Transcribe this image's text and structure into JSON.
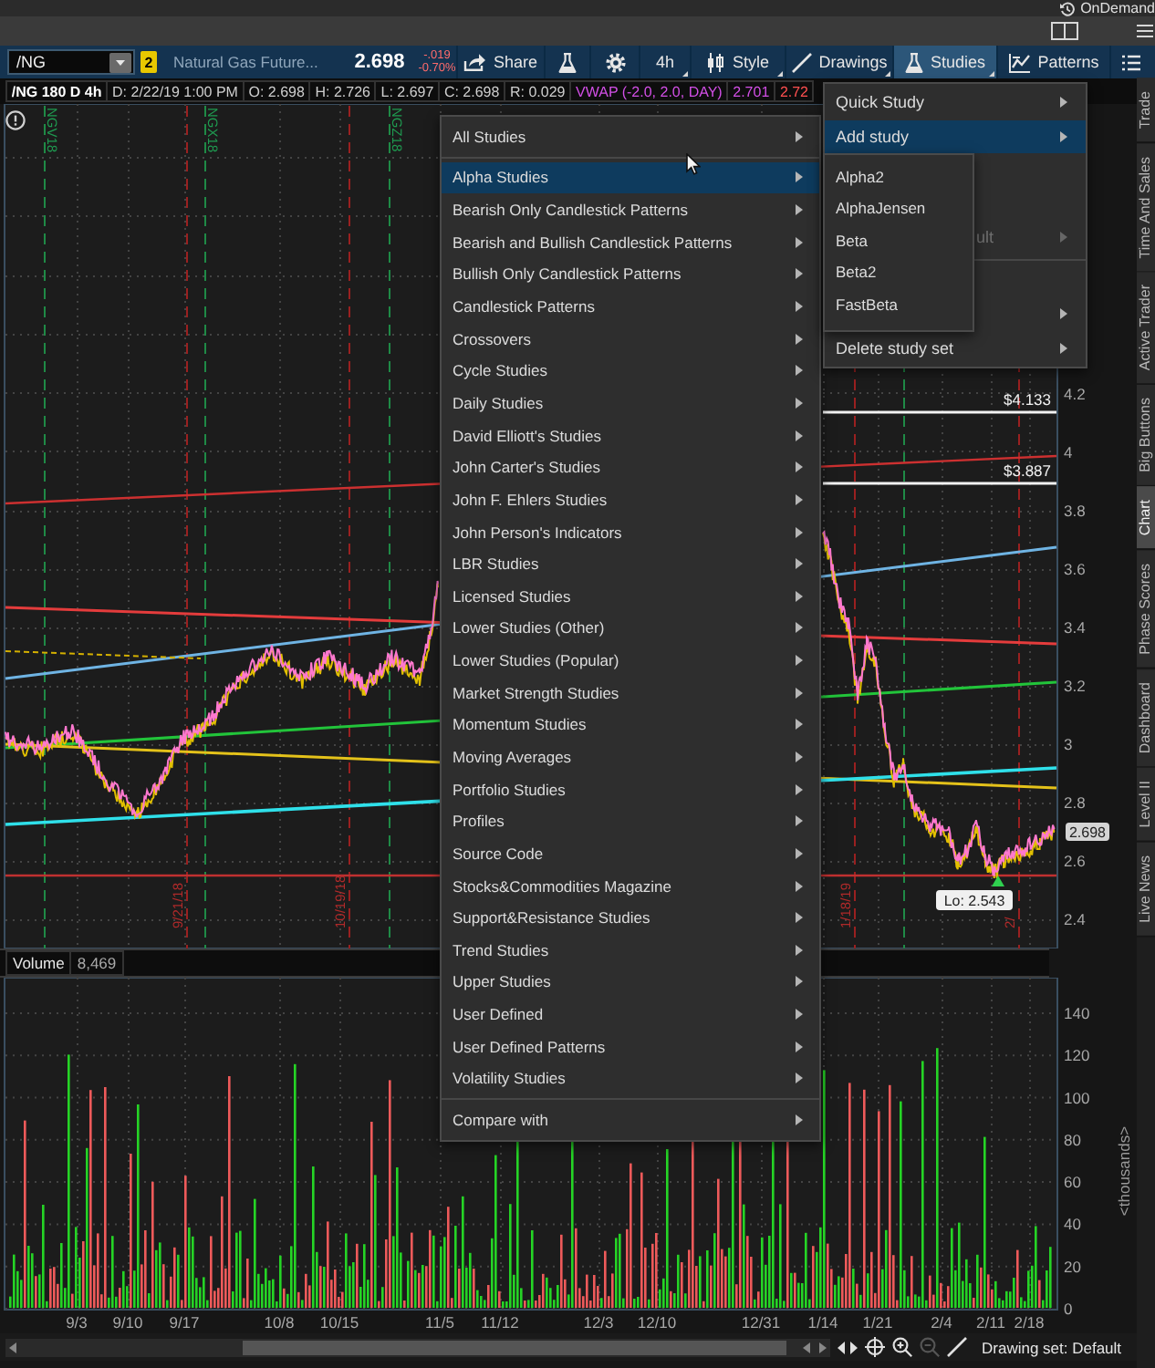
{
  "top_bar": {
    "ondemand_label": "OnDemand"
  },
  "toolbar": {
    "symbol": "/NG",
    "link_badge": "2",
    "description": "Natural Gas Future...",
    "last_price": "2.698",
    "change": "-.019",
    "change_percent": "-0.70%",
    "buttons": [
      {
        "kind": "share",
        "label": "Share",
        "selected": false
      },
      {
        "kind": "flask",
        "selected": false
      },
      {
        "kind": "gear",
        "selected": false
      },
      {
        "kind": "timeframe",
        "label": "4h",
        "selected": false
      },
      {
        "kind": "style",
        "label": "Style",
        "selected": false
      },
      {
        "kind": "drawings",
        "label": "Drawings",
        "selected": false
      },
      {
        "kind": "studies",
        "label": "Studies",
        "selected": true
      },
      {
        "kind": "patterns",
        "label": "Patterns",
        "selected": false
      },
      {
        "kind": "menu",
        "selected": false
      }
    ]
  },
  "info_bar": [
    {
      "kind": "symbol",
      "text": "/NG 180 D 4h"
    },
    {
      "kind": "field",
      "text": "D: 2/22/19 1:00 PM"
    },
    {
      "kind": "field",
      "text": "O: 2.698"
    },
    {
      "kind": "field",
      "text": "H: 2.726"
    },
    {
      "kind": "field",
      "text": "L: 2.697"
    },
    {
      "kind": "field",
      "text": "C: 2.698"
    },
    {
      "kind": "field",
      "text": "R: 0.029"
    },
    {
      "kind": "study",
      "text": "VWAP (-2.0, 2.0, DAY)"
    },
    {
      "kind": "study",
      "text": "2.701"
    },
    {
      "kind": "down",
      "text": "2.72"
    }
  ],
  "price_chart": {
    "axis_labels": [
      "4.2",
      "4",
      "3.8",
      "3.6",
      "3.4",
      "3.2",
      "3",
      "2.8",
      "2.6",
      "2.4"
    ],
    "contract_labels": [
      "NGV18",
      "NGX18",
      "NGZ18"
    ],
    "expiry_labels": [
      "9/21/18",
      "10/19/18",
      "1/18/19",
      "2/"
    ],
    "level_labels": [
      "$4.133",
      "$3.887"
    ],
    "last_price_tag": "2.698",
    "low_label": "Lo: 2.543"
  },
  "volume": {
    "title": "Volume",
    "value": "8,469",
    "axis_labels": [
      "140",
      "120",
      "100",
      "80",
      "60",
      "40",
      "20",
      "0"
    ],
    "unit": "<thousands>"
  },
  "time_axis": [
    "9/3",
    "9/10",
    "9/17",
    "10/8",
    "10/15",
    "11/5",
    "11/12",
    "12/3",
    "12/10",
    "12/31",
    "1/14",
    "1/21",
    "2/4",
    "2/11",
    "2/18"
  ],
  "bottom_bar": {
    "drawing_set": "Drawing set: Default"
  },
  "side_tabs": [
    {
      "label": "Trade",
      "selected": false
    },
    {
      "label": "Time And Sales",
      "selected": false
    },
    {
      "label": "Active Trader",
      "selected": false
    },
    {
      "label": "Big Buttons",
      "selected": false
    },
    {
      "label": "Chart",
      "selected": true
    },
    {
      "label": "Phase Scores",
      "selected": false
    },
    {
      "label": "Dashboard",
      "selected": false
    },
    {
      "label": "Level II",
      "selected": false
    },
    {
      "label": "Live News",
      "selected": false
    }
  ],
  "all_studies_menu": [
    {
      "kind": "item",
      "label": "All Studies",
      "submenu": true,
      "selected": false
    },
    {
      "kind": "separator"
    },
    {
      "kind": "item",
      "label": "Alpha Studies",
      "submenu": true,
      "selected": true
    },
    {
      "kind": "item",
      "label": "Bearish Only Candlestick Patterns",
      "submenu": true,
      "selected": false
    },
    {
      "kind": "item",
      "label": "Bearish and Bullish Candlestick Patterns",
      "submenu": true,
      "selected": false
    },
    {
      "kind": "item",
      "label": "Bullish Only Candlestick Patterns",
      "submenu": true,
      "selected": false
    },
    {
      "kind": "item",
      "label": "Candlestick Patterns",
      "submenu": true,
      "selected": false
    },
    {
      "kind": "item",
      "label": "Crossovers",
      "submenu": true,
      "selected": false
    },
    {
      "kind": "item",
      "label": "Cycle Studies",
      "submenu": true,
      "selected": false
    },
    {
      "kind": "item",
      "label": "Daily Studies",
      "submenu": true,
      "selected": false
    },
    {
      "kind": "item",
      "label": "David Elliott's Studies",
      "submenu": true,
      "selected": false
    },
    {
      "kind": "item",
      "label": "John Carter's Studies",
      "submenu": true,
      "selected": false
    },
    {
      "kind": "item",
      "label": "John F. Ehlers Studies",
      "submenu": true,
      "selected": false
    },
    {
      "kind": "item",
      "label": "John Person's Indicators",
      "submenu": true,
      "selected": false
    },
    {
      "kind": "item",
      "label": "LBR Studies",
      "submenu": true,
      "selected": false
    },
    {
      "kind": "item",
      "label": "Licensed Studies",
      "submenu": true,
      "selected": false
    },
    {
      "kind": "item",
      "label": "Lower Studies (Other)",
      "submenu": true,
      "selected": false
    },
    {
      "kind": "item",
      "label": "Lower Studies (Popular)",
      "submenu": true,
      "selected": false
    },
    {
      "kind": "item",
      "label": "Market Strength Studies",
      "submenu": true,
      "selected": false
    },
    {
      "kind": "item",
      "label": "Momentum Studies",
      "submenu": true,
      "selected": false
    },
    {
      "kind": "item",
      "label": "Moving Averages",
      "submenu": true,
      "selected": false
    },
    {
      "kind": "item",
      "label": "Portfolio Studies",
      "submenu": true,
      "selected": false
    },
    {
      "kind": "item",
      "label": "Profiles",
      "submenu": true,
      "selected": false
    },
    {
      "kind": "item",
      "label": "Source Code",
      "submenu": true,
      "selected": false
    },
    {
      "kind": "item",
      "label": "Stocks&Commodities Magazine",
      "submenu": true,
      "selected": false
    },
    {
      "kind": "item",
      "label": "Support&Resistance Studies",
      "submenu": true,
      "selected": false
    },
    {
      "kind": "item",
      "label": "Trend Studies",
      "submenu": true,
      "selected": false
    },
    {
      "kind": "item",
      "label": "Upper Studies",
      "submenu": true,
      "selected": false
    },
    {
      "kind": "item",
      "label": "User Defined",
      "submenu": true,
      "selected": false
    },
    {
      "kind": "item",
      "label": "User Defined Patterns",
      "submenu": true,
      "selected": false
    },
    {
      "kind": "item",
      "label": "Volatility Studies",
      "submenu": true,
      "selected": false
    },
    {
      "kind": "separator"
    },
    {
      "kind": "item",
      "label": "Compare with",
      "submenu": true,
      "selected": false
    }
  ],
  "studies_menu": [
    {
      "kind": "item",
      "label": "Quick Study",
      "submenu": true,
      "selected": false,
      "disabled": false
    },
    {
      "kind": "item",
      "label": "Add study",
      "submenu": true,
      "selected": true,
      "disabled": false
    },
    {
      "kind": "hidden"
    },
    {
      "kind": "hidden"
    },
    {
      "kind": "covered",
      "label": "ult",
      "submenu": true,
      "selected": false,
      "disabled": true
    },
    {
      "kind": "separator"
    },
    {
      "kind": "hidden"
    },
    {
      "kind": "hidden",
      "submenu": true
    },
    {
      "kind": "item",
      "label": "Delete study set",
      "submenu": true,
      "selected": false,
      "disabled": false
    }
  ],
  "add_study_menu": [
    {
      "kind": "item",
      "label": "Alpha2",
      "selected": false
    },
    {
      "kind": "item",
      "label": "AlphaJensen",
      "selected": false
    },
    {
      "kind": "item",
      "label": "Beta",
      "selected": false
    },
    {
      "kind": "item",
      "label": "Beta2",
      "selected": false
    },
    {
      "kind": "item",
      "label": "FastBeta",
      "selected": false
    }
  ]
}
